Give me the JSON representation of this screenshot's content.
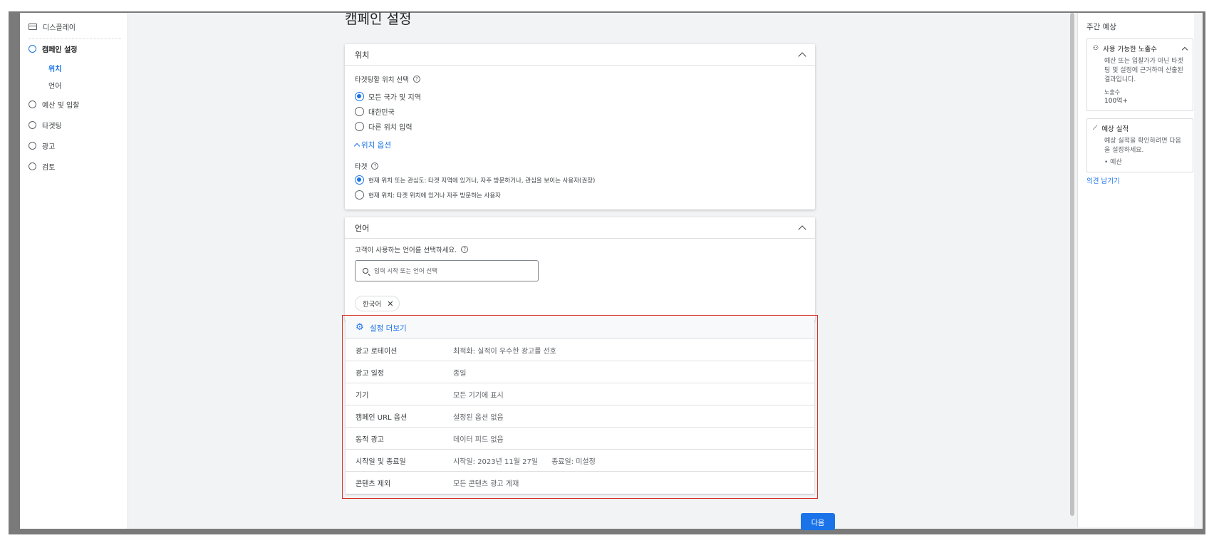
{
  "sidebar": {
    "top_label": "디스플레이",
    "steps": [
      {
        "label": "캠페인 설정",
        "active": true
      },
      {
        "label": "예산 및 입찰",
        "active": false
      },
      {
        "label": "타겟팅",
        "active": false
      },
      {
        "label": "광고",
        "active": false
      },
      {
        "label": "검토",
        "active": false
      }
    ],
    "substeps": [
      "위치",
      "언어"
    ]
  },
  "main": {
    "title": "캠페인 설정",
    "location_card": {
      "header": "위치",
      "prompt": "타겟팅할 위치 선택",
      "options": [
        "모든 국가 및 지역",
        "대한민국",
        "다른 위치 입력"
      ],
      "selected_index": 0,
      "toggle_label": "위치 옵션",
      "target_label": "타겟",
      "target_options": [
        "현재 위치 또는 관심도: 타겟 지역에 있거나, 자주 방문하거나, 관심을 보이는 사용자(권장)",
        "현재 위치: 타겟 위치에 있거나 자주 방문하는 사용자"
      ],
      "target_selected_index": 0
    },
    "language_card": {
      "header": "언어",
      "prompt": "고객이 사용하는 언어를 선택하세요.",
      "search_placeholder": "입력 시작 또는 언어 선택",
      "chip": "한국어",
      "chip_remove": "✕"
    },
    "more_settings": {
      "header": "설정 더보기",
      "rows": [
        {
          "key": "광고 로테이션",
          "value": "최적화: 실적이 우수한 광고를 선호"
        },
        {
          "key": "광고 일정",
          "value": "종일"
        },
        {
          "key": "기기",
          "value": "모든 기기에 표시"
        },
        {
          "key": "캠페인 URL 옵션",
          "value": "설정된 옵션 없음"
        },
        {
          "key": "동적 광고",
          "value": "데이터 피드 없음"
        },
        {
          "key": "시작일 및 종료일",
          "value": "시작일: 2023년 11월 27일      종료일: 미설정"
        },
        {
          "key": "콘텐츠 제외",
          "value": "모든 콘텐츠 광고 게재"
        }
      ]
    },
    "next_button": "다음"
  },
  "right_panel": {
    "title": "주간 예상",
    "reach_card": {
      "title": "사용 가능한 노출수",
      "body": "예산 또는 입찰가가 아닌 타겟팅 및 설정에 근거하여 산출된 결과입니다.",
      "metric_label": "노출수",
      "metric_value": "100억+"
    },
    "performance_card": {
      "title": "예상 실적",
      "body": "예상 실적을 확인하려면 다음을 설정하세요.",
      "bullet": "예산"
    },
    "feedback_link": "의견 남기기"
  },
  "colors": {
    "accent": "#1a73e8",
    "highlight_border": "#d93025"
  }
}
